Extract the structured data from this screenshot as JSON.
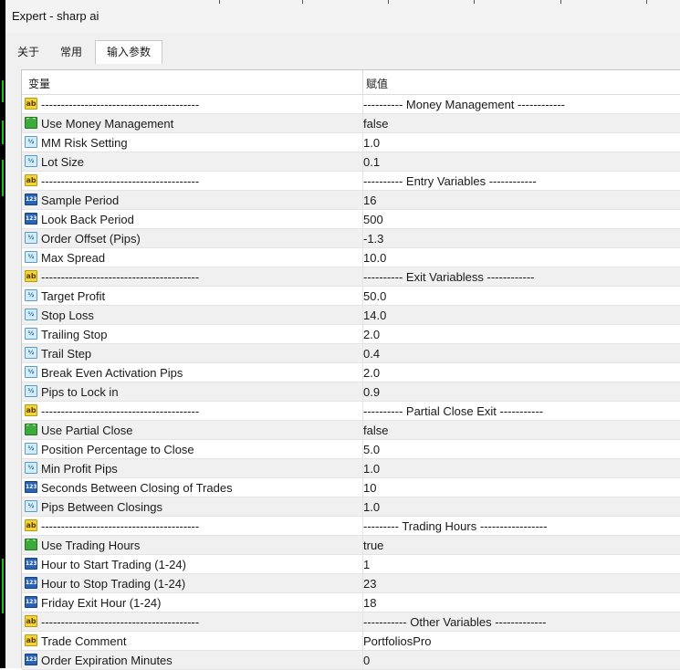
{
  "window": {
    "title": "Expert - sharp ai"
  },
  "tabs": [
    {
      "label": "关于",
      "active": false
    },
    {
      "label": "常用",
      "active": false
    },
    {
      "label": "输入参数",
      "active": true
    }
  ],
  "table": {
    "columns": {
      "variable": "变量",
      "value": "赋值"
    },
    "rows": [
      {
        "type": "ab",
        "name": "----------------------------------------",
        "value": "---------- Money Management ------------"
      },
      {
        "type": "bool",
        "name": "Use Money Management",
        "value": "false"
      },
      {
        "type": "dbl",
        "name": "MM Risk Setting",
        "value": "1.0"
      },
      {
        "type": "dbl",
        "name": "Lot Size",
        "value": "0.1"
      },
      {
        "type": "ab",
        "name": "----------------------------------------",
        "value": "---------- Entry Variables ------------"
      },
      {
        "type": "int",
        "name": "Sample Period",
        "value": "16"
      },
      {
        "type": "int",
        "name": "Look Back Period",
        "value": "500"
      },
      {
        "type": "dbl",
        "name": "Order Offset (Pips)",
        "value": "-1.3"
      },
      {
        "type": "dbl",
        "name": "Max Spread",
        "value": "10.0"
      },
      {
        "type": "ab",
        "name": "----------------------------------------",
        "value": "---------- Exit Variabless ------------"
      },
      {
        "type": "dbl",
        "name": "Target Profit",
        "value": "50.0"
      },
      {
        "type": "dbl",
        "name": "Stop Loss",
        "value": "14.0"
      },
      {
        "type": "dbl",
        "name": "Trailing Stop",
        "value": "2.0"
      },
      {
        "type": "dbl",
        "name": "Trail Step",
        "value": "0.4"
      },
      {
        "type": "dbl",
        "name": "Break Even Activation Pips",
        "value": "2.0"
      },
      {
        "type": "dbl",
        "name": "Pips to Lock in",
        "value": "0.9"
      },
      {
        "type": "ab",
        "name": "----------------------------------------",
        "value": "---------- Partial Close Exit -----------"
      },
      {
        "type": "bool",
        "name": "Use Partial Close",
        "value": "false"
      },
      {
        "type": "dbl",
        "name": "Position Percentage to Close",
        "value": "5.0"
      },
      {
        "type": "dbl",
        "name": "Min Profit Pips",
        "value": "1.0"
      },
      {
        "type": "int",
        "name": "Seconds Between Closing of Trades",
        "value": "10"
      },
      {
        "type": "dbl",
        "name": "Pips Between Closings",
        "value": "1.0"
      },
      {
        "type": "ab",
        "name": "----------------------------------------",
        "value": "--------- Trading Hours -----------------"
      },
      {
        "type": "bool",
        "name": "Use Trading Hours",
        "value": "true"
      },
      {
        "type": "int",
        "name": "Hour to Start Trading (1-24)",
        "value": "1"
      },
      {
        "type": "int",
        "name": "Hour to Stop Trading (1-24)",
        "value": "23"
      },
      {
        "type": "int",
        "name": "Friday Exit Hour (1-24)",
        "value": "18"
      },
      {
        "type": "ab",
        "name": "----------------------------------------",
        "value": "----------- Other Variables -------------"
      },
      {
        "type": "ab",
        "name": "Trade Comment",
        "value": "PortfoliosPro"
      },
      {
        "type": "int",
        "name": "Order Expiration Minutes",
        "value": "0"
      }
    ]
  },
  "type_icons": {
    "ab": {
      "glyph": "ab",
      "icon": "string-type-icon"
    },
    "bool": {
      "glyph": "⌒",
      "icon": "bool-type-icon"
    },
    "dbl": {
      "glyph": "½",
      "icon": "double-type-icon"
    },
    "int": {
      "glyph": "123",
      "icon": "integer-type-icon"
    }
  }
}
